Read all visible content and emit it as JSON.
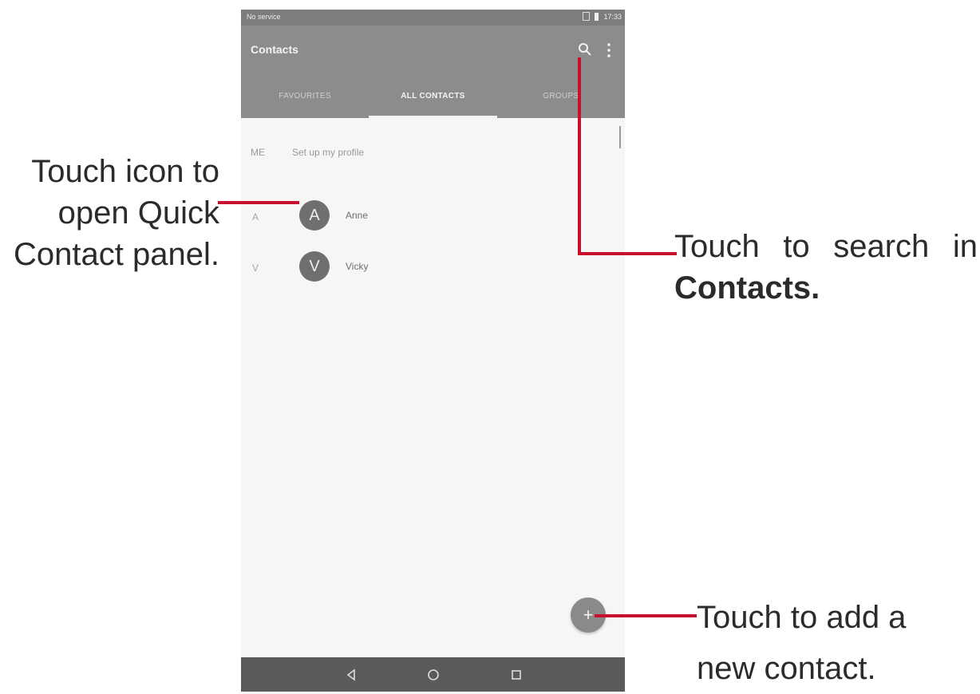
{
  "status_bar": {
    "left_text": "No service",
    "time": "17:33"
  },
  "app_bar": {
    "title": "Contacts"
  },
  "tabs": [
    {
      "label": "FAVOURITES",
      "active": false
    },
    {
      "label": "ALL CONTACTS",
      "active": true
    },
    {
      "label": "GROUPS",
      "active": false
    }
  ],
  "me_row": {
    "label": "ME",
    "text": "Set up my profile"
  },
  "contacts": [
    {
      "section": "A",
      "initial": "A",
      "name": "Anne"
    },
    {
      "section": "V",
      "initial": "V",
      "name": "Vicky"
    }
  ],
  "fab": {
    "icon": "add-contact-icon",
    "glyph": "+"
  },
  "callouts": {
    "quick_contact": [
      "Touch icon to",
      "open Quick",
      "Contact panel."
    ],
    "search": {
      "line1_words": [
        "Touch",
        "to",
        "search",
        "in"
      ],
      "line2": "Contacts."
    },
    "add": [
      "Touch to add a",
      "new contact."
    ]
  },
  "colors": {
    "app_bar": "#8c8c8c",
    "status_bar": "#7d7d7d",
    "avatar": "#6f6f6f",
    "nav_bar": "#5a5a5a",
    "leader_line": "#c8102e",
    "callout_text": "#2b2b2b"
  }
}
